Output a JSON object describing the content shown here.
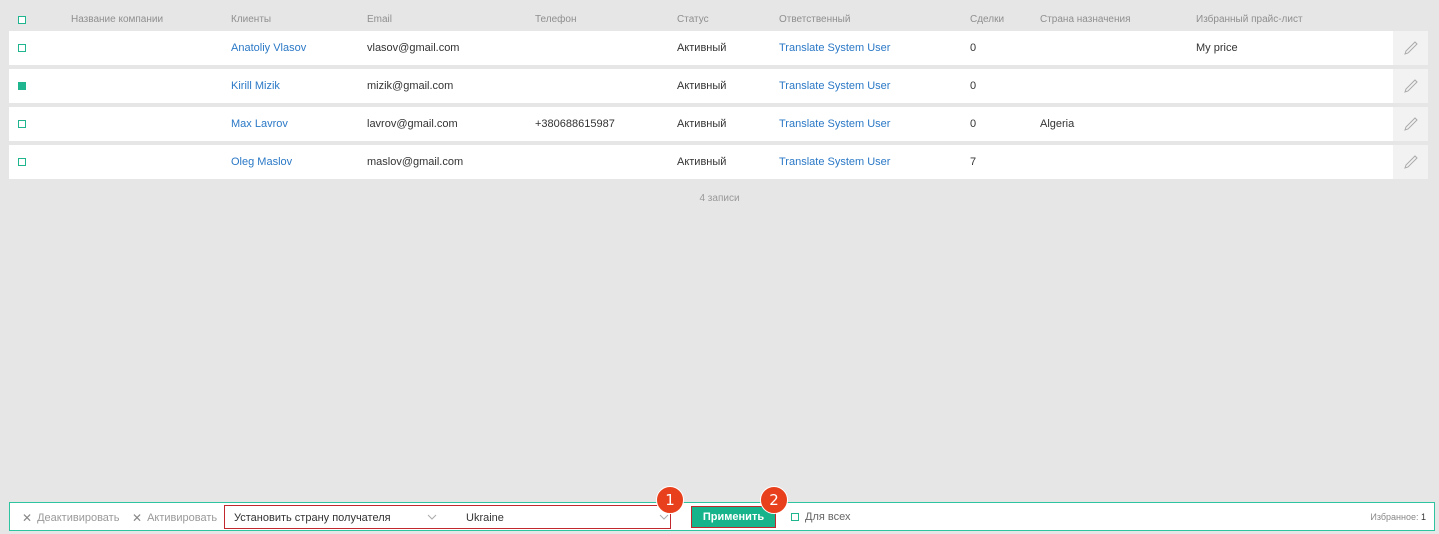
{
  "header": {
    "company": "Название компании",
    "clients": "Клиенты",
    "email": "Email",
    "phone": "Телефон",
    "status": "Статус",
    "responsible": "Ответственный",
    "deals": "Сделки",
    "country": "Страна назначения",
    "pricelist": "Избранный прайс-лист"
  },
  "rows": [
    {
      "client": "Anatoliy Vlasov",
      "email": "vlasov@gmail.com",
      "phone": "",
      "status": "Активный",
      "responsible": "Translate System User",
      "deals": "0",
      "country": "",
      "pricelist": "My price",
      "checked": false
    },
    {
      "client": "Kirill Mizik",
      "email": "mizik@gmail.com",
      "phone": "",
      "status": "Активный",
      "responsible": "Translate System User",
      "deals": "0",
      "country": "",
      "pricelist": "",
      "checked": true
    },
    {
      "client": "Max Lavrov",
      "email": "lavrov@gmail.com",
      "phone": "+380688615987",
      "status": "Активный",
      "responsible": "Translate System User",
      "deals": "0",
      "country": "Algeria",
      "pricelist": "",
      "checked": false
    },
    {
      "client": "Oleg Maslov",
      "email": "maslov@gmail.com",
      "phone": "",
      "status": "Активный",
      "responsible": "Translate System User",
      "deals": "7",
      "country": "",
      "pricelist": "",
      "checked": false
    }
  ],
  "records_count": "4 записи",
  "bottom_bar": {
    "deactivate": "Деактивировать",
    "activate": "Активировать",
    "action_select": "Установить страну получателя",
    "country_select": "Ukraine",
    "apply": "Применить",
    "for_all": "Для всех",
    "favorites_label": "Избранное:",
    "favorites_count": "1"
  },
  "badges": [
    "1",
    "2"
  ],
  "colors": {
    "accent": "#17b48c",
    "link": "#2a78c6",
    "highlight": "#c0282d",
    "badge": "#e8401c"
  }
}
